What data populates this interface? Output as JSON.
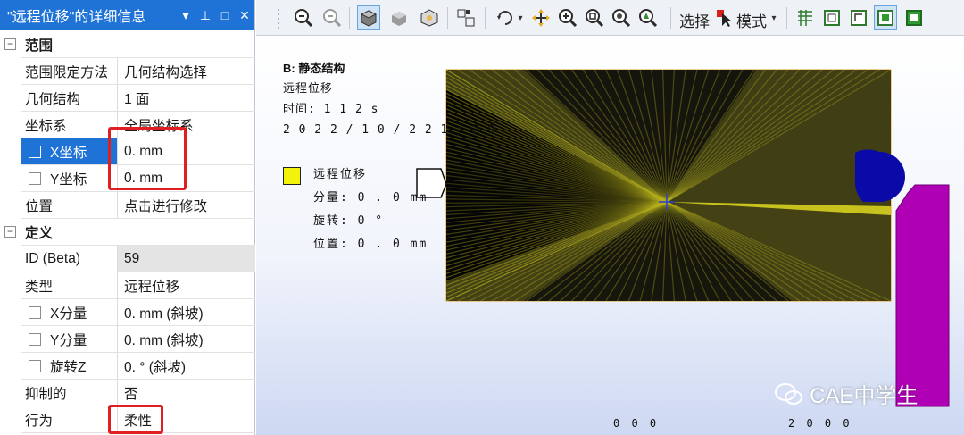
{
  "panel": {
    "title": "\"远程位移\"的详细信息",
    "header_buttons": [
      "▾",
      "⊥",
      "□",
      "✕"
    ],
    "sections": {
      "scope": "范围",
      "definition": "定义"
    },
    "rows": {
      "scoping_method": {
        "label": "范围限定方法",
        "value": "几何结构选择"
      },
      "geometry": {
        "label": "几何结构",
        "value": "1 面"
      },
      "coord_system": {
        "label": "坐标系",
        "value": "全局坐标系"
      },
      "x_coord": {
        "label": "X坐标",
        "value": "0. mm"
      },
      "y_coord": {
        "label": "Y坐标",
        "value": "0. mm"
      },
      "location": {
        "label": "位置",
        "value": "点击进行修改"
      },
      "id": {
        "label": "ID (Beta)",
        "value": "59"
      },
      "type": {
        "label": "类型",
        "value": "远程位移"
      },
      "x_component": {
        "label": "X分量",
        "value": "0. mm (斜坡)"
      },
      "y_component": {
        "label": "Y分量",
        "value": "0. mm (斜坡)"
      },
      "rotation_z": {
        "label": "旋转Z",
        "value": "0. ° (斜坡)"
      },
      "suppressed": {
        "label": "抑制的",
        "value": "否"
      },
      "behavior": {
        "label": "行为",
        "value": "柔性"
      }
    }
  },
  "toolbar": {
    "select_label": "选择",
    "mode_label": "模式",
    "icons": [
      "zoom-fit-icon",
      "zoom-box-icon",
      "iso-view-icon",
      "solid-view-icon",
      "wireframe-view-icon",
      "box-zoom-select-icon",
      "rotate-icon",
      "pan-icon",
      "zoom-in-icon",
      "zoom-out-icon",
      "magnifier-icon",
      "fit-icon",
      "select-pointer-icon",
      "grid-icon",
      "face-select-icon",
      "edge-select-icon",
      "vertex-select-icon",
      "body-select-icon"
    ]
  },
  "viewport": {
    "legend_title": "B: 静态结构",
    "legend_name": "远程位移",
    "legend_time": "时间: 1 1 2 s",
    "legend_date": "2 0 2 2 / 1 0 / 2 2 1 : 2 9",
    "legend_item_name": "远程位移",
    "legend_item_component": "分量: 0 . 0 mm",
    "legend_item_rotation": "旋转: 0 °",
    "legend_item_position": "位置: 0 . 0 mm",
    "bottom_labels": [
      "0 0 0",
      "2 0 0 0"
    ],
    "watermark": "CAE中学生",
    "colors": {
      "mesh_yellow": "#c8c21e",
      "remote_point_blue": "#0a0aa8",
      "rigid_body_magenta": "#b000b5",
      "legend_swatch": "#f2f20a"
    }
  }
}
